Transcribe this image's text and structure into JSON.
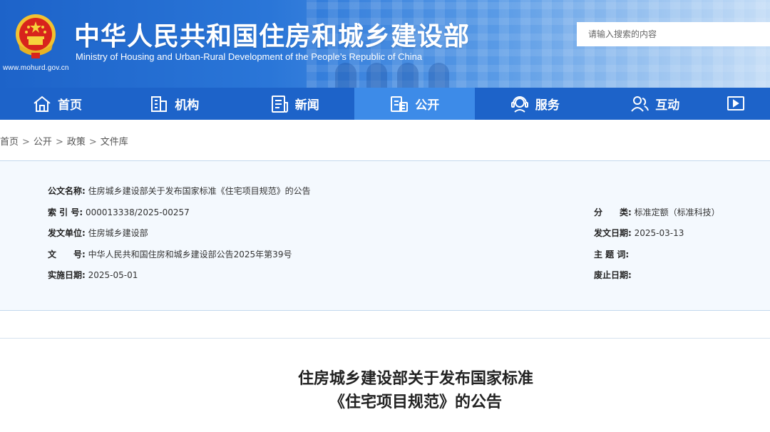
{
  "header": {
    "site_title": "中华人民共和国住房和城乡建设部",
    "site_subtitle": "Ministry of Housing and Urban-Rural Development of the People’s Republic of China",
    "site_url": "www.mohurd.gov.cn",
    "search_placeholder": "请输入搜索的内容",
    "brand_color": "#1d63c9",
    "emblem_icon": "national-emblem-icon"
  },
  "nav": {
    "items": [
      {
        "label": "首页",
        "icon": "home-icon"
      },
      {
        "label": "机构",
        "icon": "building-icon"
      },
      {
        "label": "新闻",
        "icon": "news-icon"
      },
      {
        "label": "公开",
        "icon": "document-open-icon",
        "active": true
      },
      {
        "label": "服务",
        "icon": "service-icon"
      },
      {
        "label": "互动",
        "icon": "interaction-icon"
      },
      {
        "label": "",
        "icon": "data-icon"
      }
    ],
    "active_color": "#3d8be8"
  },
  "breadcrumb": [
    "首页",
    "公开",
    "政策",
    "文件库"
  ],
  "info": {
    "title_label": "公文名称:",
    "title_value": "住房城乡建设部关于发布国家标准《住宅项目规范》的公告",
    "index_label": "索 引 号:",
    "index_value": "000013338/2025-00257",
    "category_label": "分　　类:",
    "category_value": "标准定额（标准科技）",
    "issuer_label": "发文单位:",
    "issuer_value": "住房城乡建设部",
    "issue_date_label": "发文日期:",
    "issue_date_value": "2025-03-13",
    "docnum_label": "文　　号:",
    "docnum_value": "中华人民共和国住房和城乡建设部公告2025年第39号",
    "keywords_label": "主 题 词:",
    "keywords_value": "",
    "effective_label": "实施日期:",
    "effective_value": "2025-05-01",
    "abolish_label": "废止日期:",
    "abolish_value": ""
  },
  "document": {
    "title_line1": "住房城乡建设部关于发布国家标准",
    "title_line2": "《住宅项目规范》的公告"
  }
}
